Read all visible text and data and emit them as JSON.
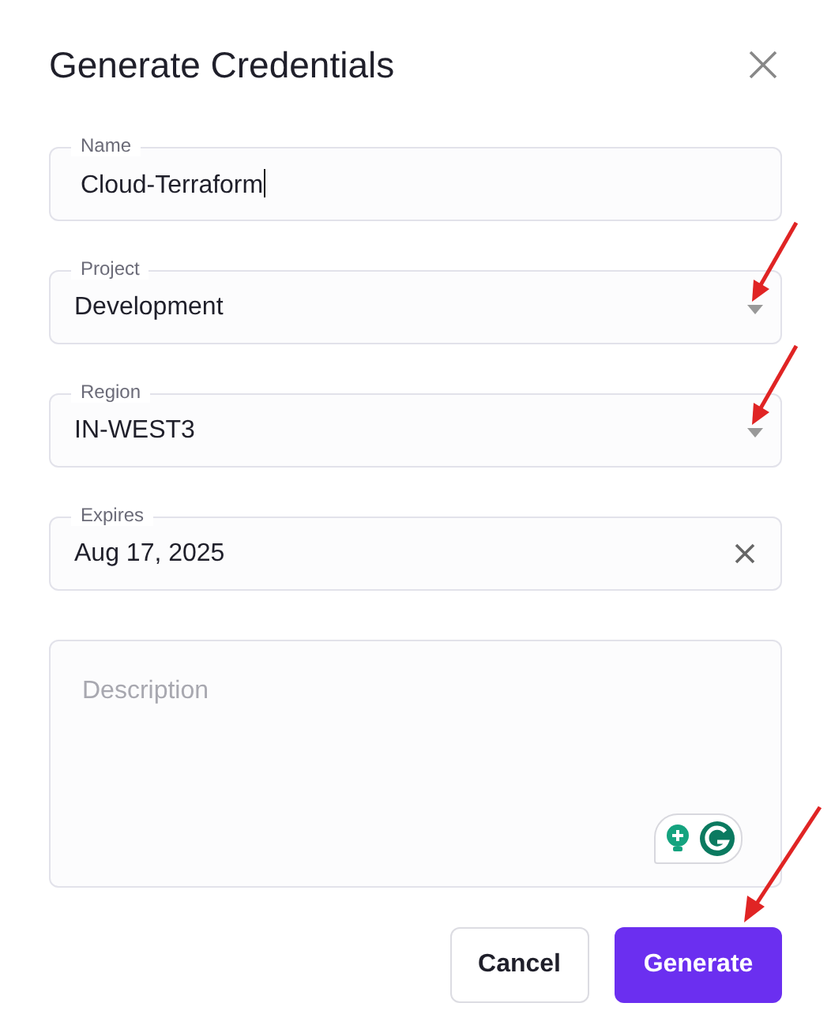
{
  "dialog": {
    "title": "Generate Credentials"
  },
  "fields": [
    {
      "kind": "text",
      "label": "Name",
      "value": "Cloud-Terraform"
    },
    {
      "kind": "select",
      "label": "Project",
      "value": "Development"
    },
    {
      "kind": "select",
      "label": "Region",
      "value": "IN-WEST3"
    },
    {
      "kind": "date",
      "label": "Expires",
      "value": "Aug 17, 2025"
    },
    {
      "kind": "textarea",
      "placeholder": "Description"
    }
  ],
  "buttons": [
    {
      "label": "Cancel",
      "kind": "secondary"
    },
    {
      "label": "Generate",
      "kind": "primary"
    }
  ]
}
